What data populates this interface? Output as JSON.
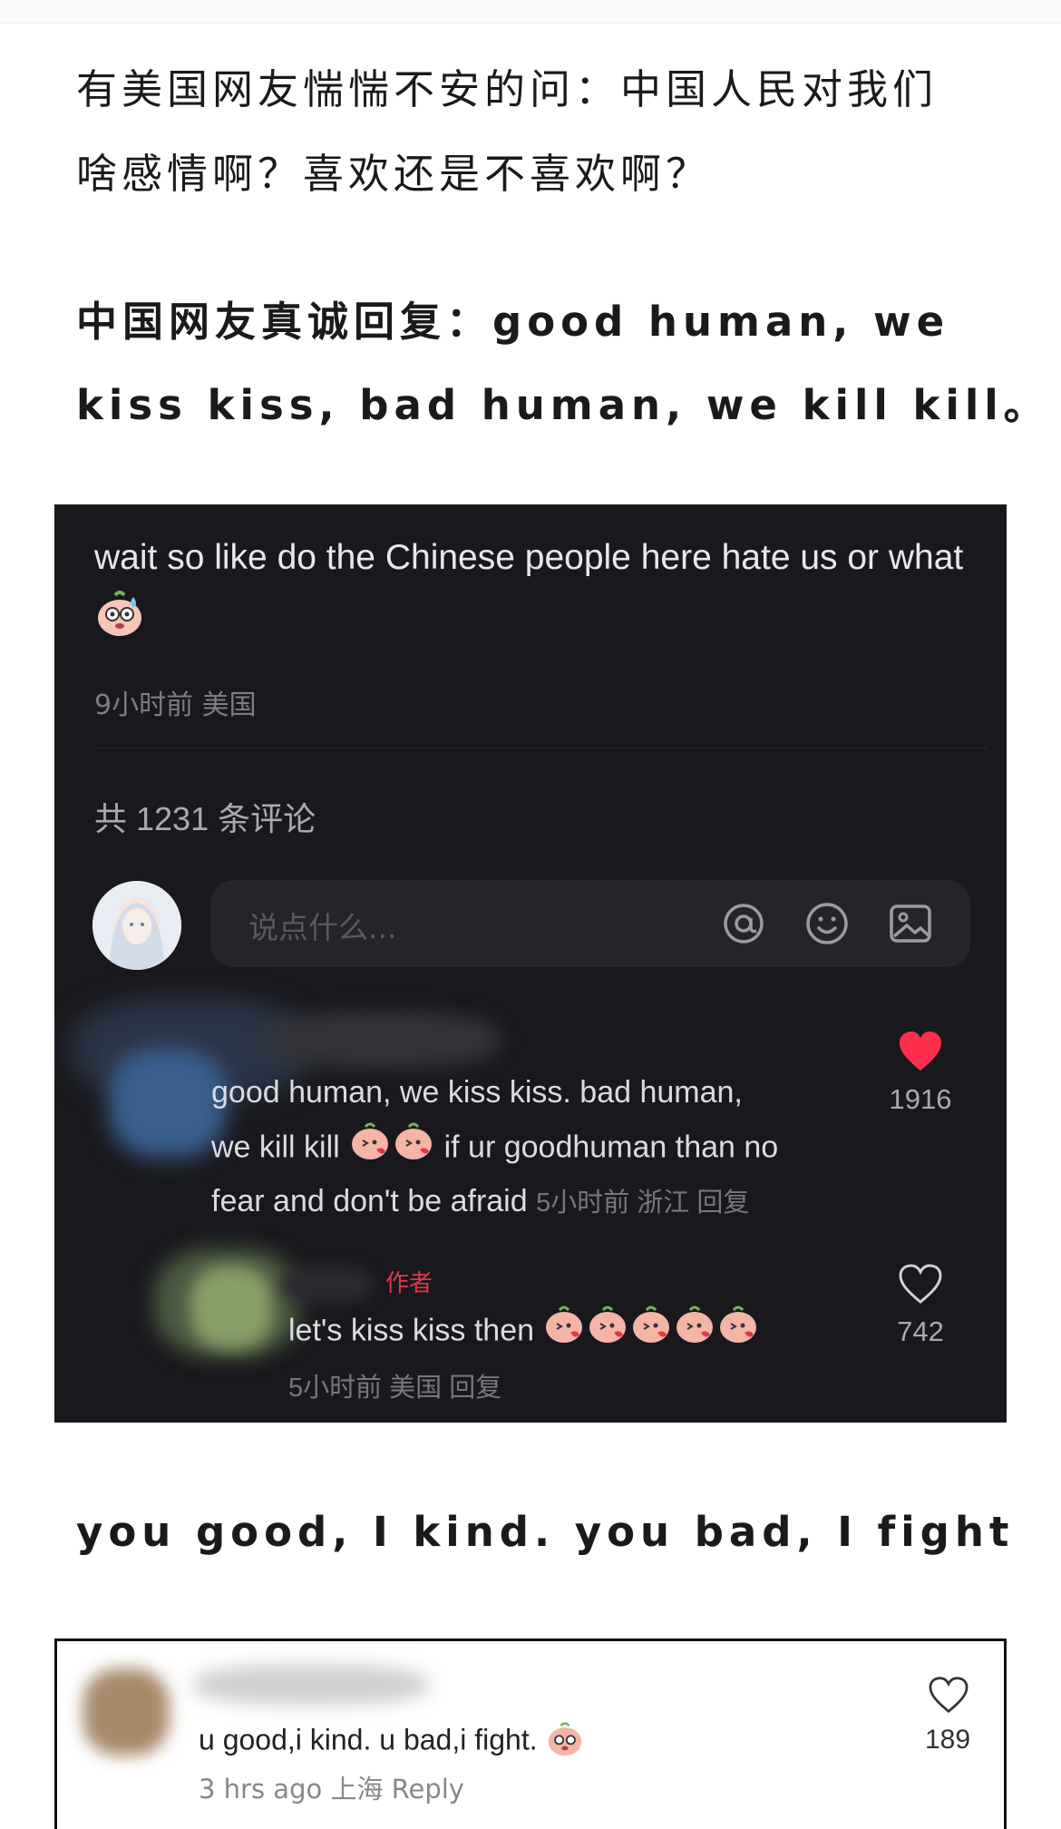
{
  "captions": {
    "line1": "有美国网友惴惴不安的问：中国人民对我们",
    "line2": "啥感情啊？喜欢还是不喜欢啊？",
    "line3": "中国网友真诚回复：good human, we",
    "line4": "kiss kiss, bad human, we kill kill。",
    "line5": "you good, I kind. you bad, I fight"
  },
  "post": {
    "text": "wait so like do the Chinese people here hate us or what",
    "emoji": "sweat-face-emoji",
    "meta": "9小时前 美国",
    "comment_count": "共 1231 条评论"
  },
  "input": {
    "placeholder": "说点什么..."
  },
  "comment1": {
    "line1": "good human, we kiss kiss.  bad human,",
    "line2a": "we kill kill",
    "line2b": "if ur goodhuman than no",
    "line3": "fear and don't be afraid",
    "meta": "5小时前 浙江 回复",
    "likes": "1916",
    "liked": true
  },
  "reply1": {
    "author_tag": "作者",
    "text": "let's kiss kiss then",
    "meta": "5小时前 美国 回复",
    "likes": "742"
  },
  "bottom_comment": {
    "text": "u good,i kind.  u bad,i fight.",
    "meta": "3 hrs ago 上海 Reply",
    "likes": "189"
  },
  "colors": {
    "dark_bg": "#19191d",
    "like_red": "#ff2e4d",
    "author_red": "#e0374b"
  }
}
